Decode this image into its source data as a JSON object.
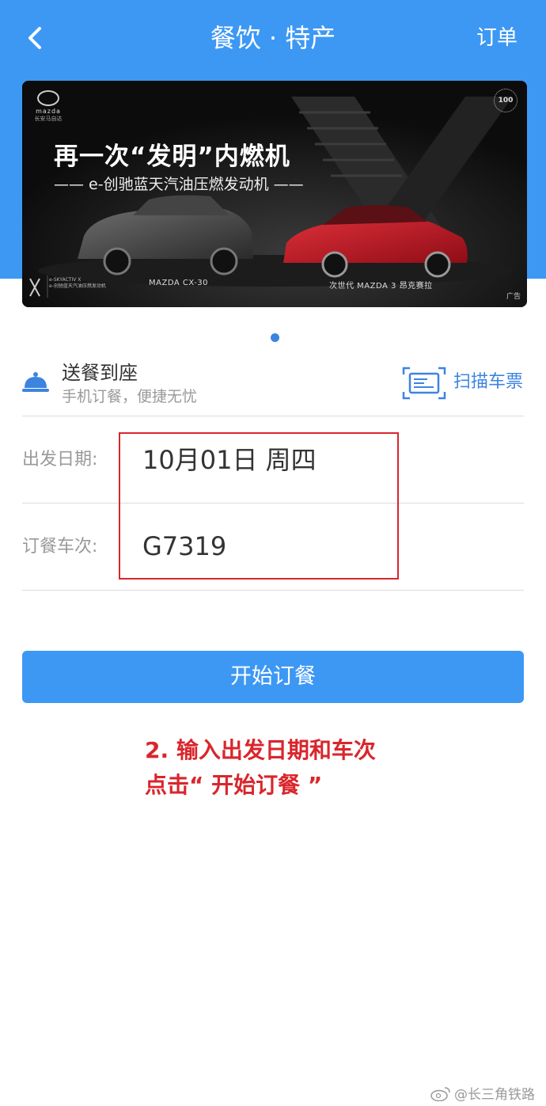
{
  "header": {
    "title": "餐饮 · 特产",
    "order_link": "订单"
  },
  "banner": {
    "headline": "再一次“发明”内燃机",
    "subline": "—— e-创驰蓝天汽油压燃发动机 ——",
    "brand_logo": "mazda",
    "brand_cn": "长安马自达",
    "badge": "100",
    "model_left": "MAZDA CX-30",
    "model_right": "次世代 MAZDA 3 昂克赛拉",
    "skyactiv_line1": "e-SKYACTIV X",
    "skyactiv_line2": "e-创驰蓝天汽油压燃发动机",
    "ad_tag": "广告",
    "slide_count": 1,
    "active_slide": 1
  },
  "delivery": {
    "title": "送餐到座",
    "subtitle": "手机订餐，便捷无忧",
    "icon": "cloche-icon",
    "scan_label": "扫描车票",
    "scan_icon": "ticket-scan-icon"
  },
  "form": {
    "date_label": "出发日期:",
    "date_value": "10月01日 周四",
    "train_label": "订餐车次:",
    "train_value": "G7319"
  },
  "start_button": "开始订餐",
  "annotation": {
    "line1": "2. 输入出发日期和车次",
    "line2": "点击“ 开始订餐 ”"
  },
  "watermark": "@长三角铁路",
  "colors": {
    "primary_blue": "#3d98f4",
    "highlight_red": "#d9262c"
  }
}
